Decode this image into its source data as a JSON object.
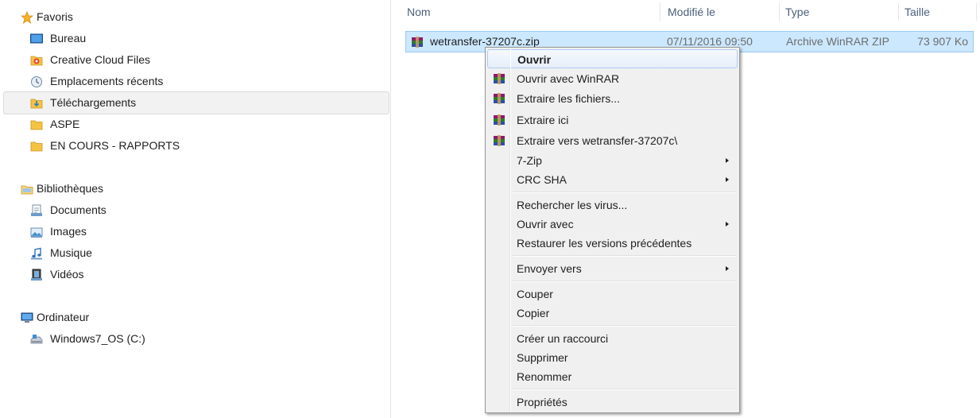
{
  "nav": {
    "favorites": {
      "label": "Favoris",
      "items": [
        {
          "label": "Bureau",
          "icon": "desktop-icon"
        },
        {
          "label": "Creative Cloud Files",
          "icon": "creative-cloud-icon"
        },
        {
          "label": "Emplacements récents",
          "icon": "recent-places-icon"
        },
        {
          "label": "Téléchargements",
          "icon": "downloads-folder-icon"
        },
        {
          "label": "ASPE",
          "icon": "folder-icon"
        },
        {
          "label": "EN COURS - RAPPORTS",
          "icon": "folder-icon"
        }
      ]
    },
    "libraries": {
      "label": "Bibliothèques",
      "items": [
        {
          "label": "Documents",
          "icon": "documents-icon"
        },
        {
          "label": "Images",
          "icon": "images-icon"
        },
        {
          "label": "Musique",
          "icon": "music-icon"
        },
        {
          "label": "Vidéos",
          "icon": "videos-icon"
        }
      ]
    },
    "computer": {
      "label": "Ordinateur",
      "items": [
        {
          "label": "Windows7_OS (C:)",
          "icon": "drive-icon"
        }
      ]
    }
  },
  "columns": {
    "name": "Nom",
    "modified": "Modifié le",
    "type": "Type",
    "size": "Taille"
  },
  "file": {
    "name": "wetransfer-37207c.zip",
    "modified": "07/11/2016 09:50",
    "type": "Archive WinRAR ZIP",
    "size": "73 907 Ko"
  },
  "context_menu": {
    "open": "Ouvrir",
    "open_winrar": "Ouvrir avec WinRAR",
    "extract_files": "Extraire les fichiers...",
    "extract_here": "Extraire ici",
    "extract_to": "Extraire vers wetransfer-37207c\\",
    "seven_zip": "7-Zip",
    "crc_sha": "CRC SHA",
    "scan_virus": "Rechercher les virus...",
    "open_with": "Ouvrir avec",
    "restore_versions": "Restaurer les versions précédentes",
    "send_to": "Envoyer vers",
    "cut": "Couper",
    "copy": "Copier",
    "create_shortcut": "Créer un raccourci",
    "delete": "Supprimer",
    "rename": "Renommer",
    "properties": "Propriétés"
  },
  "colors": {
    "selection_bg": "#cce8ff",
    "selection_border": "#99c9ef",
    "menu_bg": "#f0f0f0",
    "header_text": "#4c607a"
  }
}
